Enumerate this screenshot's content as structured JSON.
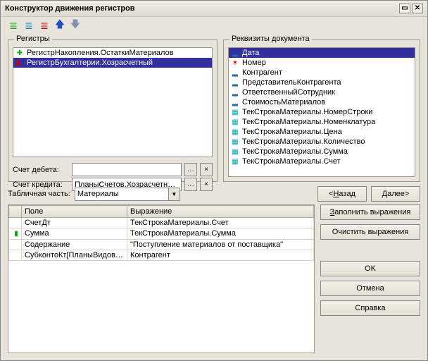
{
  "window": {
    "title": "Конструктор движения регистров"
  },
  "panels": {
    "registers": "Регистры",
    "docRequisites": "Реквизиты документа"
  },
  "registers": [
    {
      "icon": "plus-green",
      "label": "РегистрНакопления.ОстаткиМатериалов",
      "selected": false
    },
    {
      "icon": "dr-red",
      "label": "РегистрБухгалтерии.Хозрасчетный",
      "selected": true
    }
  ],
  "accounts": {
    "debitLabel": "Счет дебета:",
    "debitValue": "",
    "creditLabel": "Счет кредита:",
    "creditValue": "ПланыСчетов.Хозрасчетный.Пс"
  },
  "requisites": [
    {
      "icon": "dash-blue",
      "label": "Дата",
      "selected": true
    },
    {
      "icon": "star-red",
      "label": "Номер"
    },
    {
      "icon": "dash-blue",
      "label": "Контрагент"
    },
    {
      "icon": "dash-blue",
      "label": "ПредставительКонтрагента"
    },
    {
      "icon": "dash-blue",
      "label": "ОтветственныйСотрудник"
    },
    {
      "icon": "dash-blue",
      "label": "СтоимостьМатериалов"
    },
    {
      "icon": "table-teal",
      "label": "ТекСтрокаМатериалы.НомерСтроки"
    },
    {
      "icon": "table-teal",
      "label": "ТекСтрокаМатериалы.Номенклатура"
    },
    {
      "icon": "table-teal",
      "label": "ТекСтрокаМатериалы.Цена"
    },
    {
      "icon": "table-teal",
      "label": "ТекСтрокаМатериалы.Количество"
    },
    {
      "icon": "table-teal",
      "label": "ТекСтрокаМатериалы.Сумма"
    },
    {
      "icon": "table-teal",
      "label": "ТекСтрокаМатериалы.Счет"
    }
  ],
  "tabPart": {
    "label": "Табличная часть:",
    "value": "Материалы"
  },
  "table": {
    "colField": "Поле",
    "colExpr": "Выражение",
    "rows": [
      {
        "icon": "",
        "field": "СчетДт",
        "expr": "ТекСтрокаМатериалы.Счет"
      },
      {
        "icon": "green-bar",
        "field": "Сумма",
        "expr": "ТекСтрокаМатериалы.Сумма"
      },
      {
        "icon": "",
        "field": "Содержание",
        "expr": "\"Поступление материалов от поставщика\""
      },
      {
        "icon": "",
        "field": "СубконтоКт[ПланыВидовХа...",
        "expr": "Контрагент"
      }
    ]
  },
  "buttons": {
    "back": "<Назад",
    "next": "Далее>",
    "fill": "Заполнить выражения",
    "clear": "Очистить выражения",
    "ok": "OK",
    "cancel": "Отмена",
    "help": "Справка"
  }
}
